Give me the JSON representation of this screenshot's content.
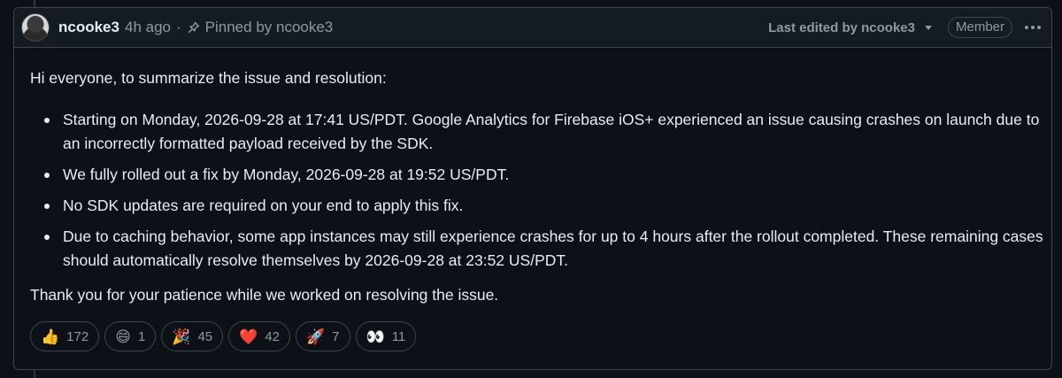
{
  "header": {
    "author": "ncooke3",
    "time": "4h ago",
    "separator": "·",
    "pinned_text": "Pinned by ncooke3",
    "edited_text": "Last edited by ncooke3",
    "role_badge": "Member"
  },
  "body": {
    "intro": "Hi everyone, to summarize the issue and resolution:",
    "points": [
      "Starting on Monday, 2026-09-28 at 17:41 US/PDT. Google Analytics for Firebase iOS+ experienced an issue causing crashes on launch due to an incorrectly formatted payload received by the SDK.",
      "We fully rolled out a fix by Monday, 2026-09-28 at 19:52 US/PDT.",
      "No SDK updates are required on your end to apply this fix.",
      "Due to caching behavior, some app instances may still experience crashes for up to 4 hours after the rollout completed. These remaining cases should automatically resolve themselves by 2026-09-28 at 23:52 US/PDT."
    ],
    "closing": "Thank you for your patience while we worked on resolving the issue."
  },
  "reactions": [
    {
      "emoji": "👍",
      "icon": "thumbs-up-icon",
      "count": "172"
    },
    {
      "emoji": "😄",
      "icon": "laugh-icon",
      "count": "1"
    },
    {
      "emoji": "🎉",
      "icon": "hooray-icon",
      "count": "45"
    },
    {
      "emoji": "❤️",
      "icon": "heart-icon",
      "count": "42"
    },
    {
      "emoji": "🚀",
      "icon": "rocket-icon",
      "count": "7"
    },
    {
      "emoji": "👀",
      "icon": "eyes-icon",
      "count": "11"
    }
  ],
  "colors": {
    "background": "#0d1117",
    "header_bg": "#151b23",
    "border": "#3d444d",
    "text": "#e6edf3",
    "muted": "#9198a1"
  }
}
